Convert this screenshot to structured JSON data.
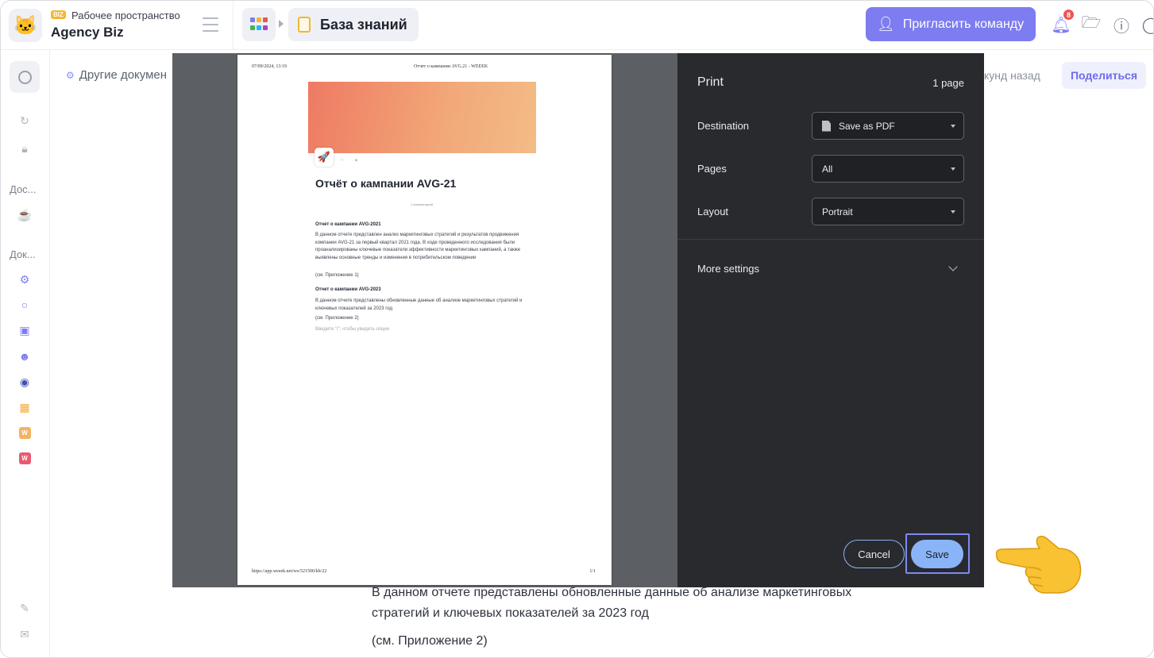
{
  "workspace": {
    "badge": "BIZ",
    "caption": "Рабочее пространство",
    "name": "Agency Biz"
  },
  "header": {
    "breadcrumb_title": "База знаний",
    "invite_label": "Пригласить команду",
    "notifications_count": "8"
  },
  "rail": {
    "label_1": "Дос...",
    "label_2": "Док...",
    "tile_1": "W",
    "tile_2": "W"
  },
  "page": {
    "breadcrumb": "Другие докумен",
    "saved_ago": "кунд назад",
    "share_label": "Поделиться",
    "bg_line_1": "В данном отчете представлены обновленные данные об анализе маркетинговых",
    "bg_line_2": "стратегий и ключевых показателей за 2023 год",
    "bg_line_3": "(см. Приложение 2)"
  },
  "preview": {
    "header_left": "07/09/2024, 13:19",
    "header_center": "Отчет о кампании AVG.21 - WEEEK",
    "title": "Отчёт о кампании AVG-21",
    "comments": "1 комментарий",
    "h1": "Отчет о кампании AVG-2021",
    "p1": "В данном отчете представлен анализ маркетинговых стратегий и результатов продвижения компании AVG-21 за первый квартал 2021 года. В ходе проведенного исследования были проанализированы ключевые показатели эффективности маркетинговых кампаний, а также выявлены основные тренды и изменения в потребительском поведении",
    "ref1": "(см. Приложение 1)",
    "h2": "Отчет о кампании AVG-2023",
    "p2": "В данном отчете представлены обновленные данные об анализе маркетинговых стратегий и ключевых показателей за 2023 год",
    "ref2": "(см. Приложение 2)",
    "hint": "Введите \"/\", чтобы увидеть опции",
    "footer_left": "https://app.weeek.net/ws/521500/kb/22",
    "footer_right": "1/1"
  },
  "print_dialog": {
    "title": "Print",
    "page_count": "1 page",
    "destination_label": "Destination",
    "destination_value": "Save as PDF",
    "pages_label": "Pages",
    "pages_value": "All",
    "layout_label": "Layout",
    "layout_value": "Portrait",
    "more_settings": "More settings",
    "cancel": "Cancel",
    "save": "Save"
  },
  "colors": {
    "accent": "#7d7cf0",
    "panel_bg": "#292a2d",
    "save_blue": "#8ab4f8"
  }
}
